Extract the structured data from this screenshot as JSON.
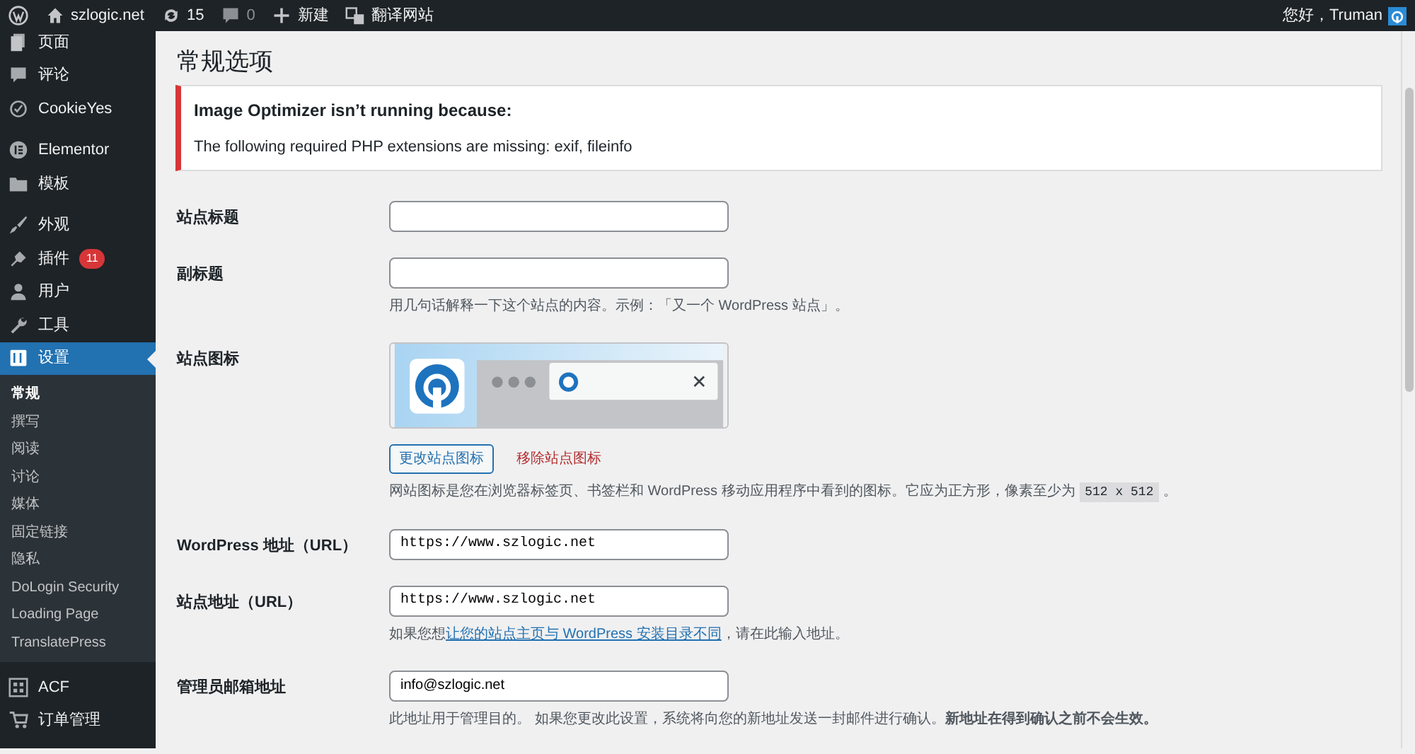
{
  "admin_bar": {
    "site": "szlogic.net",
    "updates": "15",
    "comments": "0",
    "new": "新建",
    "translate": "翻译网站",
    "greeting": "您好，Truman"
  },
  "sidebar": {
    "items": [
      {
        "label": "页面",
        "selected": false
      },
      {
        "label": "评论",
        "selected": false
      },
      {
        "label": "CookieYes",
        "selected": false
      },
      {
        "label": "Elementor",
        "selected": false
      },
      {
        "label": "模板",
        "selected": false
      },
      {
        "label": "外观",
        "selected": false
      },
      {
        "label": "插件",
        "badge": "11",
        "selected": false
      },
      {
        "label": "用户",
        "selected": false
      },
      {
        "label": "工具",
        "selected": false
      },
      {
        "label": "设置",
        "selected": true,
        "children": [
          {
            "label": "常规",
            "selected": true
          },
          {
            "label": "撰写",
            "selected": false
          },
          {
            "label": "阅读",
            "selected": false
          },
          {
            "label": "讨论",
            "selected": false
          },
          {
            "label": "媒体",
            "selected": false
          },
          {
            "label": "固定链接",
            "selected": false
          },
          {
            "label": "隐私",
            "selected": false
          },
          {
            "label": "DoLogin Security",
            "selected": false
          },
          {
            "label": "Loading Page",
            "selected": false
          },
          {
            "label": "TranslatePress",
            "selected": false
          }
        ]
      },
      {
        "label": "ACF",
        "selected": false
      },
      {
        "label": "订单管理",
        "selected": false
      }
    ]
  },
  "page_title": "常规选项",
  "notice": {
    "title": "Image Optimizer isn’t running because:",
    "message": "The following required PHP extensions are missing: exif, fileinfo"
  },
  "form": [
    {
      "kind": "text",
      "label": "站点标题"
    },
    {
      "kind": "text",
      "label": "副标题",
      "description": "用几句话解释一下这个站点的内容。示例：「又一个 WordPress 站点」。"
    },
    {
      "kind": "site_icon",
      "label": "站点图标",
      "change_button": "更改站点图标",
      "remove_link": "移除站点图标",
      "description": "网站图标是您在浏览器标签页、书签栏和 WordPress 移动应用程序中看到的图标。它应为正方形，像素至少为",
      "code": "512 x 512",
      "description_end": "。"
    },
    {
      "kind": "url",
      "label": "WordPress 地址（URL）",
      "value": "https://www.szlogic.net"
    },
    {
      "kind": "url",
      "label": "站点地址（URL）",
      "value": "https://www.szlogic.net",
      "description": "如果您想",
      "link": "让您的站点主页与 WordPress 安装目录不同",
      "description_end": "，请在此输入地址。"
    },
    {
      "kind": "email",
      "label": "管理员邮箱地址",
      "value": "info@szlogic.net",
      "description": "此地址用于管理目的。 如果您更改此设置，系统将向您的新地址发送一封邮件进行确认。**新地址在得到确认之前不会生效。**"
    }
  ]
}
